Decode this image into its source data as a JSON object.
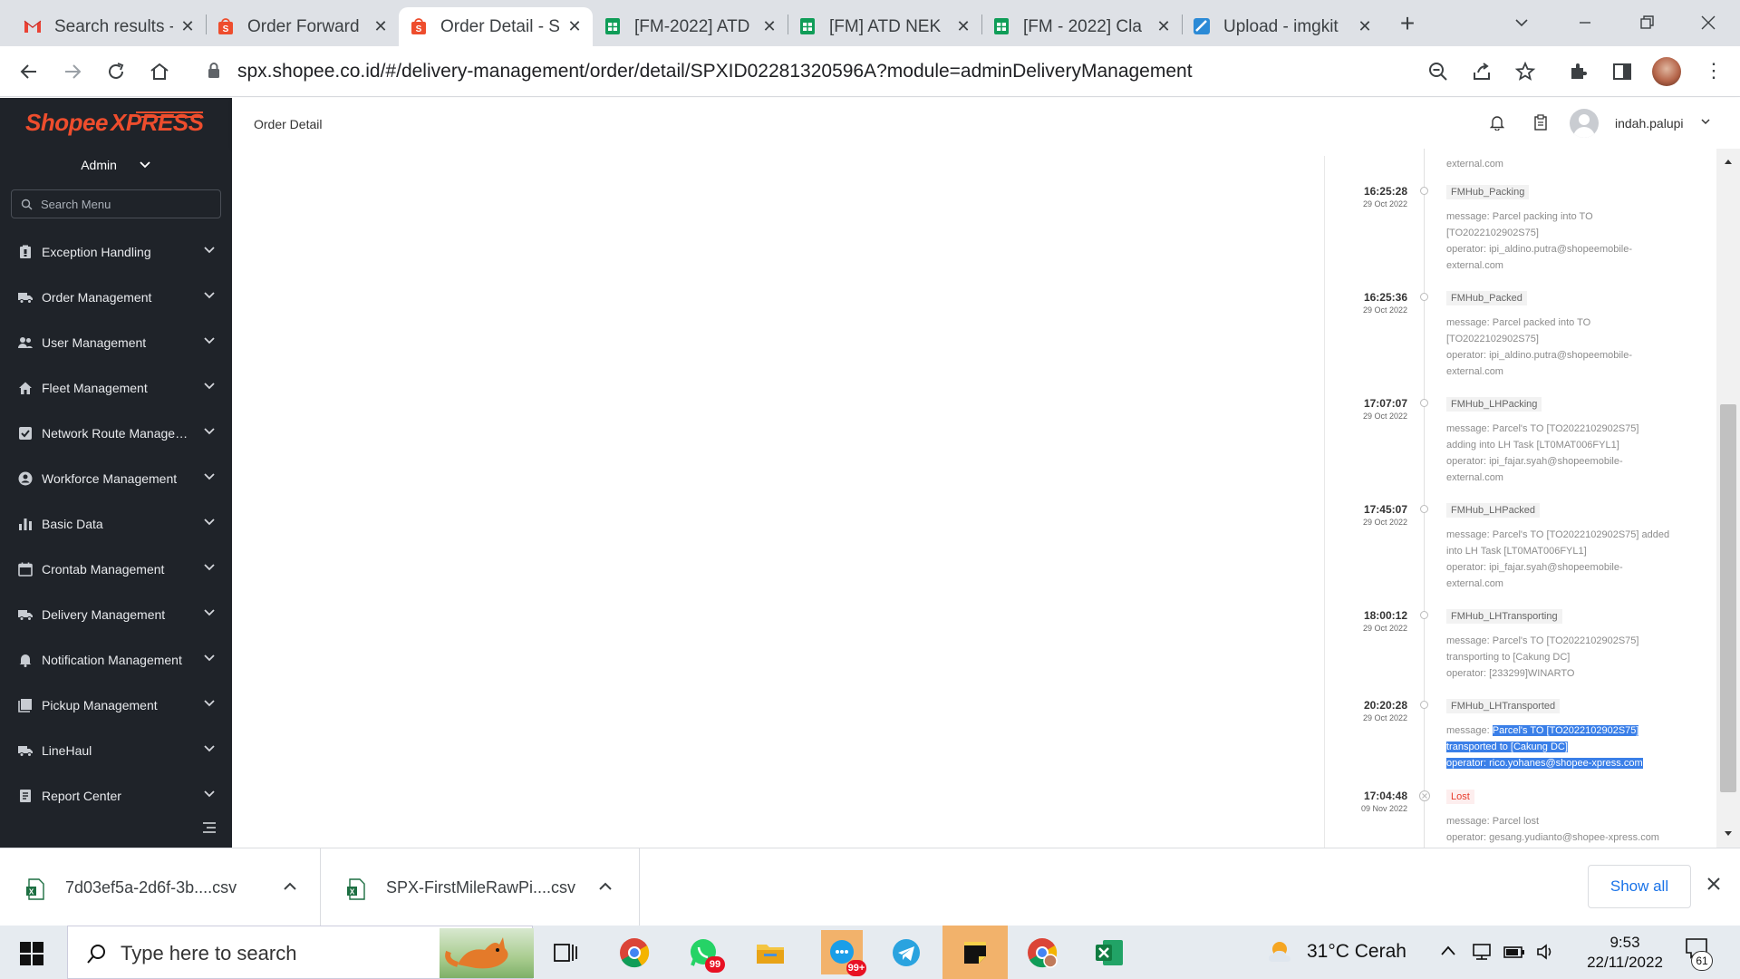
{
  "browser": {
    "tabs": [
      {
        "title": "Search results - ",
        "icon": "gmail-icon"
      },
      {
        "title": "Order Forward",
        "icon": "shopee-icon"
      },
      {
        "title": "Order Detail - S",
        "icon": "shopee-icon"
      },
      {
        "title": "[FM-2022] ATD",
        "icon": "sheets-icon"
      },
      {
        "title": "[FM] ATD NEK",
        "icon": "sheets-icon"
      },
      {
        "title": "[FM - 2022] Cla",
        "icon": "sheets-icon"
      },
      {
        "title": "Upload - imgkit",
        "icon": "imgkit-icon"
      }
    ],
    "url": "spx.shopee.co.id/#/delivery-management/order/detail/SPXID02281320596A?module=adminDeliveryManagement"
  },
  "sidebar": {
    "logo_text": "Shopee XPRESS",
    "role": "Admin",
    "search_placeholder": "Search Menu",
    "items": [
      {
        "label": "Exception Handling",
        "icon": "clipboard-icon"
      },
      {
        "label": "Order Management",
        "icon": "truck-icon"
      },
      {
        "label": "User Management",
        "icon": "users-icon"
      },
      {
        "label": "Fleet Management",
        "icon": "home-icon"
      },
      {
        "label": "Network Route Management",
        "icon": "check-square-icon"
      },
      {
        "label": "Workforce Management",
        "icon": "user-circle-icon"
      },
      {
        "label": "Basic Data",
        "icon": "bar-chart-icon"
      },
      {
        "label": "Crontab Management",
        "icon": "calendar-icon"
      },
      {
        "label": "Delivery Management",
        "icon": "truck-icon"
      },
      {
        "label": "Notification Management",
        "icon": "bell-icon"
      },
      {
        "label": "Pickup Management",
        "icon": "book-icon"
      },
      {
        "label": "LineHaul",
        "icon": "truck-icon"
      },
      {
        "label": "Report Center",
        "icon": "report-icon"
      }
    ]
  },
  "header": {
    "title": "Order Detail",
    "username": "indah.palupi"
  },
  "timeline": {
    "top_fragment": "external.com",
    "events": [
      {
        "time": "16:25:28",
        "date": "29 Oct 2022",
        "status": "FMHub_Packing",
        "lines": [
          "message: Parcel packing into TO",
          "[TO2022102902S75]",
          "operator: ipi_aldino.putra@shopeemobile-",
          "external.com"
        ]
      },
      {
        "time": "16:25:36",
        "date": "29 Oct 2022",
        "status": "FMHub_Packed",
        "lines": [
          "message: Parcel packed into TO",
          "[TO2022102902S75]",
          "operator: ipi_aldino.putra@shopeemobile-",
          "external.com"
        ]
      },
      {
        "time": "17:07:07",
        "date": "29 Oct 2022",
        "status": "FMHub_LHPacking",
        "lines": [
          "message: Parcel's TO [TO2022102902S75]",
          "adding into LH Task [LT0MAT006FYL1]",
          "operator: ipi_fajar.syah@shopeemobile-",
          "external.com"
        ]
      },
      {
        "time": "17:45:07",
        "date": "29 Oct 2022",
        "status": "FMHub_LHPacked",
        "lines": [
          "message: Parcel's TO [TO2022102902S75] added",
          "into LH Task [LT0MAT006FYL1]",
          "operator: ipi_fajar.syah@shopeemobile-",
          "external.com"
        ]
      },
      {
        "time": "18:00:12",
        "date": "29 Oct 2022",
        "status": "FMHub_LHTransporting",
        "lines": [
          "message: Parcel's TO [TO2022102902S75]",
          "transporting to [Cakung DC]",
          "operator: [233299]WINARTO"
        ]
      },
      {
        "time": "20:20:28",
        "date": "29 Oct 2022",
        "status": "FMHub_LHTransported",
        "lines": [
          "message: Parcel's TO [TO2022102902S75]",
          "transported to [Cakung DC]",
          "operator: rico.yohanes@shopee-xpress.com"
        ]
      },
      {
        "time": "17:04:48",
        "date": "09 Nov 2022",
        "status": "Lost",
        "lines": [
          "message: Parcel lost",
          "operator: gesang.yudianto@shopee-xpress.com"
        ]
      }
    ]
  },
  "downloads": {
    "files": [
      "7d03ef5a-2d6f-3b....csv",
      "SPX-FirstMileRawPi....csv"
    ],
    "show_all": "Show all"
  },
  "taskbar": {
    "search_placeholder": "Type here to search",
    "whatsapp_badge": "99",
    "chat_badge": "99+",
    "weather": "31°C  Cerah",
    "time": "9:53",
    "date": "22/11/2022",
    "notifications": "61"
  },
  "colors": {
    "brand": "#ee4d2d",
    "sidebar_bg": "#1f2329",
    "selection": "#3a7fe8",
    "lost": "#e83b2b"
  }
}
